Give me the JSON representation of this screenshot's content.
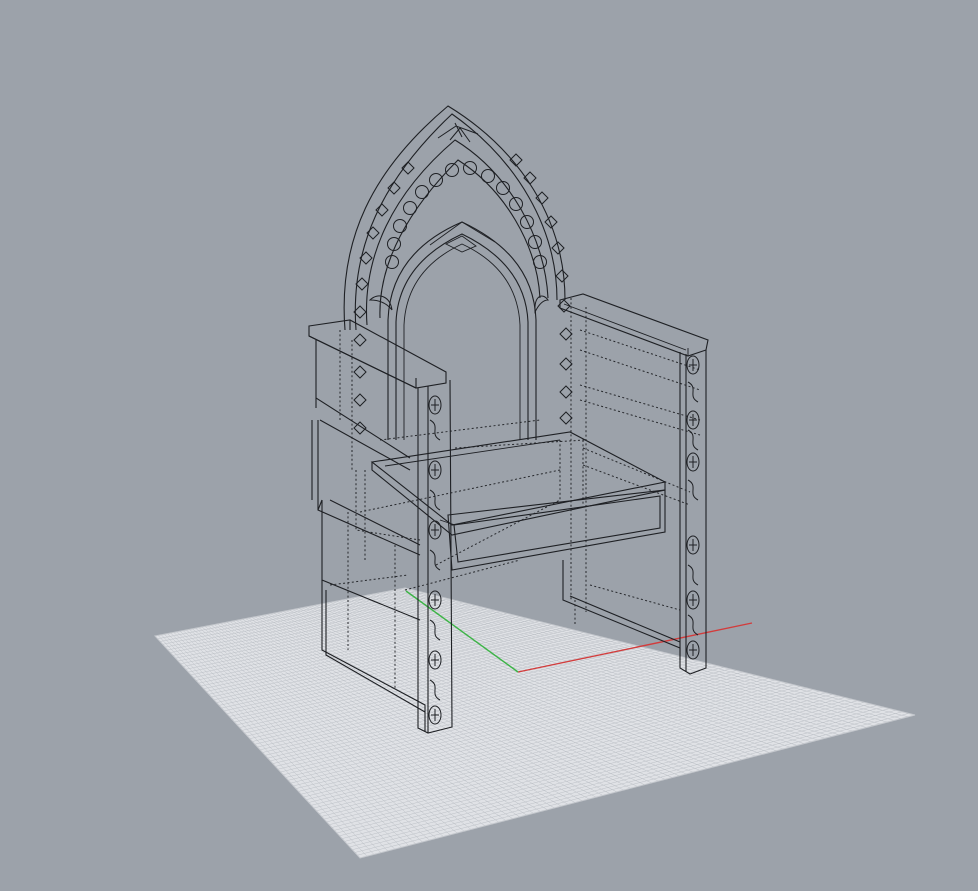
{
  "viewport": {
    "background_color": "#9ca2aa",
    "grid_color": "#e0e2e6",
    "grid_line_color": "#bcc0c6",
    "x_axis_color": "#d23c3c",
    "y_axis_color": "#3cb446",
    "wire_color": "#1e2024",
    "object": "gothic-throne-chair-wireframe"
  }
}
